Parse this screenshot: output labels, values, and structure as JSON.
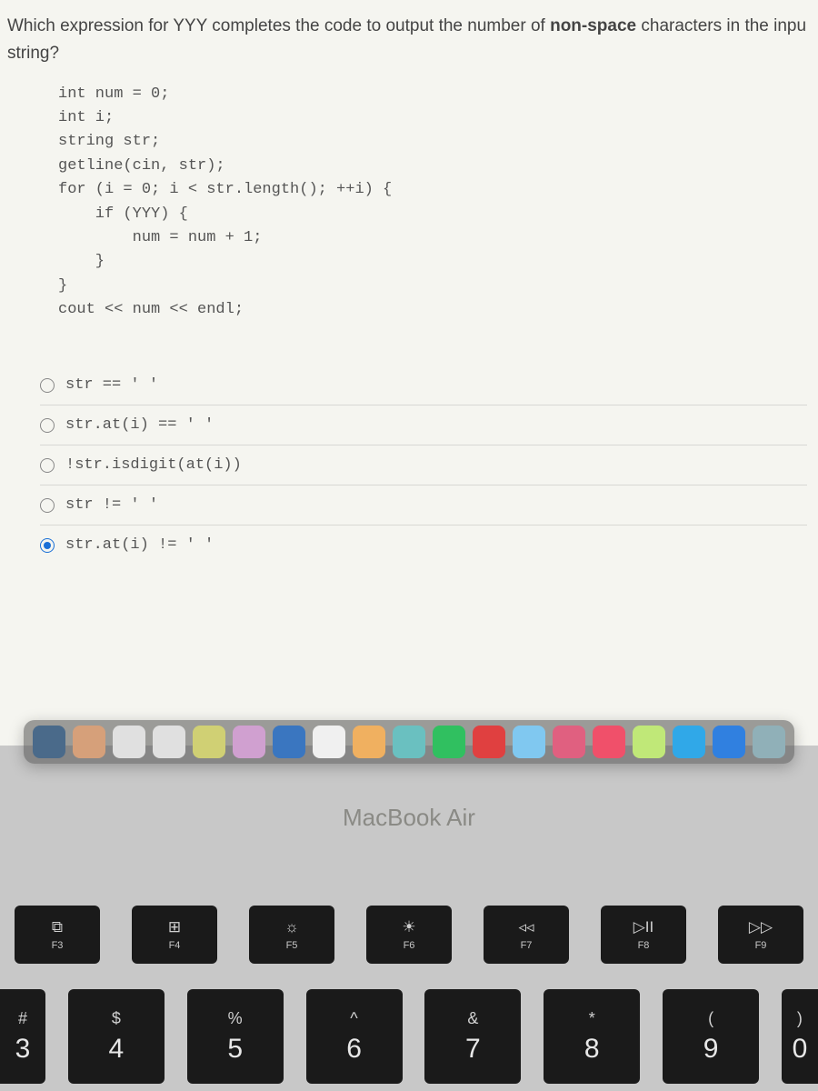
{
  "question": {
    "line1a": "Which expression for YYY completes the code to output the number of ",
    "bold": "non-space",
    "line1b": " characters in the inpu",
    "line2": "string?"
  },
  "code": "int num = 0;\nint i;\nstring str;\ngetline(cin, str);\nfor (i = 0; i < str.length(); ++i) {\n    if (YYY) {\n        num = num + 1;\n    }\n}\ncout << num << endl;",
  "options": [
    {
      "label": "str == ' '",
      "selected": false
    },
    {
      "label": "str.at(i) == ' '",
      "selected": false
    },
    {
      "label": "!str.isdigit(at(i))",
      "selected": false
    },
    {
      "label": "str != ' '",
      "selected": false
    },
    {
      "label": "str.at(i) != ' '",
      "selected": true
    }
  ],
  "macbook": "MacBook Air",
  "fn_keys": [
    {
      "icon": "⧉",
      "label": "F3"
    },
    {
      "icon": "⊞",
      "label": "F4"
    },
    {
      "icon": "☼",
      "label": "F5"
    },
    {
      "icon": "☀",
      "label": "F6"
    },
    {
      "icon": "◃◃",
      "label": "F7"
    },
    {
      "icon": "▷II",
      "label": "F8"
    },
    {
      "icon": "▷▷",
      "label": "F9"
    }
  ],
  "num_keys": [
    {
      "sym": "#",
      "main": "3",
      "cls": "half-left"
    },
    {
      "sym": "$",
      "main": "4",
      "cls": ""
    },
    {
      "sym": "%",
      "main": "5",
      "cls": ""
    },
    {
      "sym": "^",
      "main": "6",
      "cls": ""
    },
    {
      "sym": "&",
      "main": "7",
      "cls": ""
    },
    {
      "sym": "*",
      "main": "8",
      "cls": ""
    },
    {
      "sym": "(",
      "main": "9",
      "cls": ""
    },
    {
      "sym": ")",
      "main": "0",
      "cls": "half-right"
    }
  ],
  "dock_icons": [
    "#4a6a8a",
    "#d6a07a",
    "#e0e0e0",
    "#e0e0e0",
    "#d0d074",
    "#d0a0d0",
    "#3a76c0",
    "#f0f0f0",
    "#f0b060",
    "#6ac0c0",
    "#30c060",
    "#e04040",
    "#80c8f0",
    "#e06080",
    "#f0506a",
    "#c0e878",
    "#30a8e8",
    "#3080e0",
    "#90b0b8"
  ]
}
